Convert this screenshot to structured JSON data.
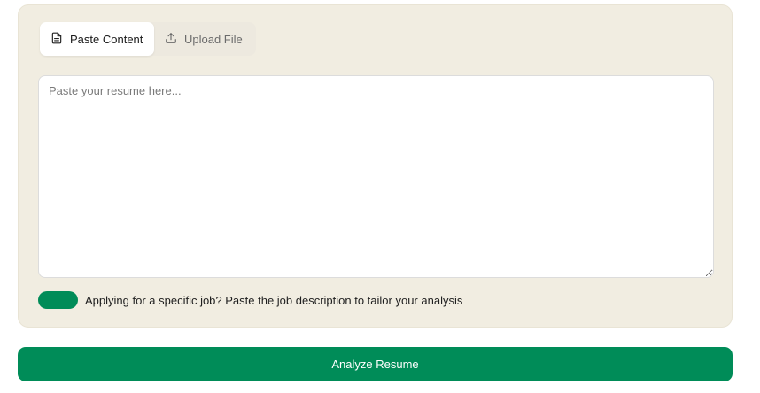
{
  "tabs": [
    {
      "label": "Paste Content",
      "icon": "document-icon",
      "active": true
    },
    {
      "label": "Upload File",
      "icon": "upload-icon",
      "active": false
    }
  ],
  "resume_input": {
    "placeholder": "Paste your resume here...",
    "value": ""
  },
  "job_toggle": {
    "label": "Applying for a specific job? Paste the job description to tailor your analysis",
    "enabled": true
  },
  "analyze_button": {
    "label": "Analyze Resume"
  },
  "colors": {
    "card_background": "#f1ede1",
    "accent_green": "#008c58"
  }
}
